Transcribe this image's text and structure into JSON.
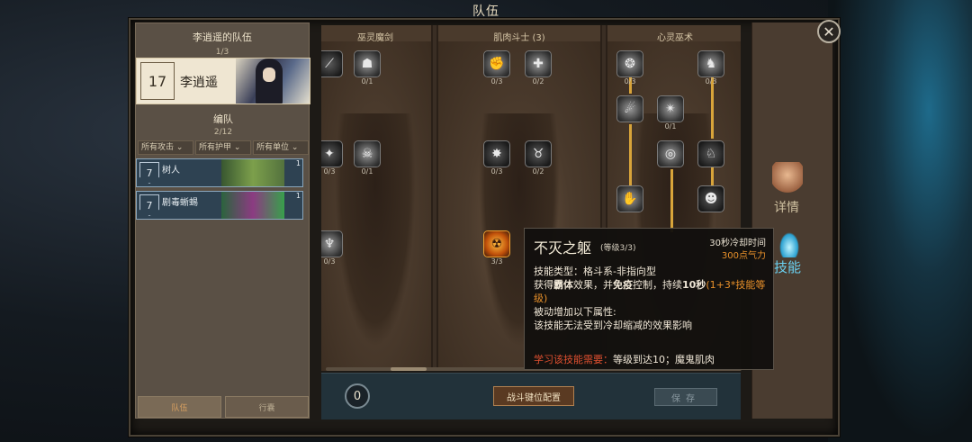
{
  "window_title": "队伍",
  "roster": {
    "title": "李逍遥的队伍",
    "count": "1/3",
    "hero": {
      "level": "17",
      "name": "李逍遥"
    },
    "squad_title": "编队",
    "squad_count": "2/12",
    "filters": [
      "所有攻击",
      "所有护甲",
      "所有单位"
    ],
    "units": [
      {
        "level": "7",
        "name": "树人",
        "count": "1"
      },
      {
        "level": "7",
        "name": "剧毒蜥蜴",
        "count": "1"
      }
    ],
    "tabs": [
      "队伍",
      "行囊"
    ]
  },
  "tree": {
    "columns": [
      "巫灵魔剑",
      "肌肉斗士 (3)",
      "心灵巫术"
    ],
    "counts": {
      "c1_r1": "0/1",
      "c1_r2a": "0/3",
      "c1_r2b": "0/1",
      "c1_r3": "0/3",
      "c2_r1a": "0/3",
      "c2_r1b": "0/2",
      "c2_r2a": "0/3",
      "c2_r2b": "0/2",
      "c2_r3": "3/3",
      "c3_r1a": "0/3",
      "c3_r1b": "0/3",
      "c3_r2": "0/1"
    }
  },
  "bottom": {
    "points": "0",
    "keys_button": "战斗键位配置",
    "save_button": "保存"
  },
  "right_tabs": {
    "detail": "详情",
    "skill": "技能"
  },
  "tooltip": {
    "title": "不灭之躯",
    "level": "(等级3/3)",
    "cooldown": "30秒冷却时间",
    "cost": "300点气力",
    "type": "技能类型：格斗系-非指向型",
    "effect_a": "获得",
    "effect_b": "霸体",
    "effect_c": "效果，并",
    "effect_d": "免疫",
    "effect_e": "控制，持续",
    "effect_f": "10秒",
    "effect_g": "(1+3*技能等级)",
    "passive": "被动增加以下属性:",
    "note": "该技能无法受到冷却缩减的效果影响",
    "req_label": "学习该技能需要：",
    "req_value": "等级到达10；魔鬼肌肉"
  },
  "colors": {
    "accent": "#e8902a",
    "link": "#d8a43a",
    "unit_bg": "#2e4252"
  }
}
